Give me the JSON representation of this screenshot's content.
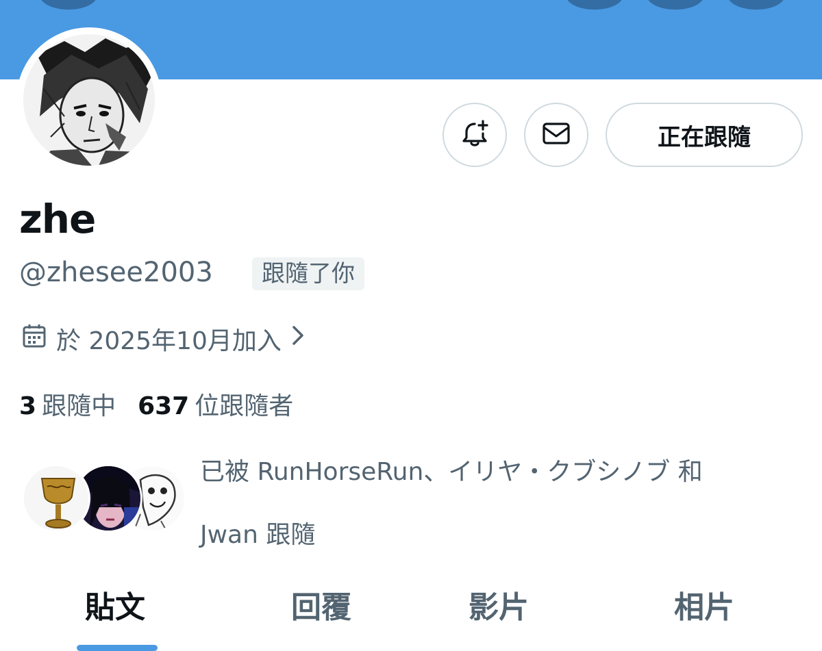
{
  "profile": {
    "display_name": "zhe",
    "handle": "@zhesee2003",
    "follows_you_badge": "跟隨了你",
    "joined": "於 2025年10月加入"
  },
  "actions": {
    "follow_state_label": "正在跟隨",
    "notify_icon": "bell-plus-icon",
    "message_icon": "envelope-icon"
  },
  "stats": {
    "following_count": "3",
    "following_label": "跟隨中",
    "followers_count": "637",
    "followers_label": "位跟隨者"
  },
  "mutual_followers": {
    "line1": "已被 RunHorseRun、イリヤ・クブシノブ 和",
    "line2": "Jwan 跟隨"
  },
  "tabs": [
    {
      "label": "貼文",
      "active": true
    },
    {
      "label": "回覆",
      "active": false
    },
    {
      "label": "影片",
      "active": false
    },
    {
      "label": "相片",
      "active": false
    }
  ],
  "colors": {
    "banner": "#4a99e3",
    "accent": "#4a99e3",
    "secondary_text": "#536471"
  }
}
